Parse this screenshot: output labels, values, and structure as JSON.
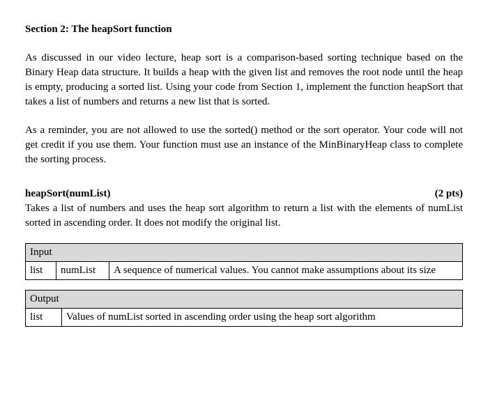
{
  "section": {
    "title": "Section 2: The heapSort function"
  },
  "paragraphs": {
    "p1": "As discussed in our video lecture, heap sort is a comparison-based sorting technique based on the Binary Heap data structure. It builds a heap with the given list and removes the root node until the heap is empty, producing a sorted list. Using your code from Section 1, implement the function heapSort that takes a list of numbers and returns a new list that is sorted.",
    "p2": "As a reminder, you are not allowed to use the sorted() method or the sort operator. Your code will not get credit if you use them. Your function must use an instance of the MinBinaryHeap class to complete the sorting process."
  },
  "spec": {
    "name": "heapSort(numList)",
    "points": "(2 pts)",
    "description": "Takes a list of numbers and uses the heap sort algorithm to return a list with the elements of numList sorted in ascending order. It does not modify the original list."
  },
  "input_table": {
    "header": "Input",
    "row": {
      "type": "list",
      "name": "numList",
      "desc": "A sequence of numerical values. You cannot make assumptions about its size"
    }
  },
  "output_table": {
    "header": "Output",
    "row": {
      "type": "list",
      "desc": "Values of numList sorted in ascending order using the heap sort algorithm"
    }
  }
}
